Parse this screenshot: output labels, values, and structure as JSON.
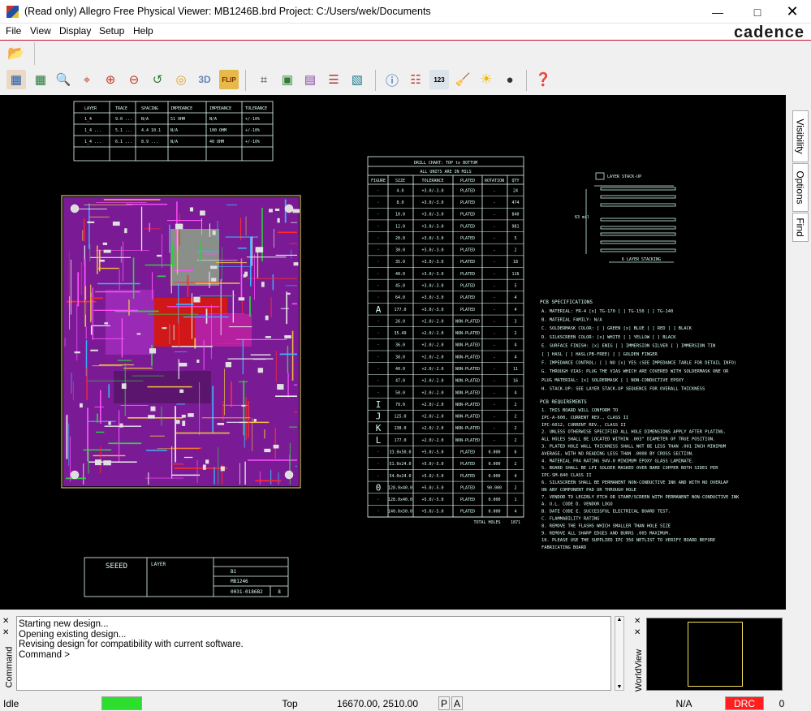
{
  "window": {
    "title": "(Read only) Allegro Free Physical Viewer: MB1246B.brd  Project: C:/Users/wek/Documents"
  },
  "menu": {
    "items": [
      "File",
      "View",
      "Display",
      "Setup",
      "Help"
    ],
    "brand": "cadence"
  },
  "toolbar": {
    "open_icon": "folder-open-icon",
    "buttons": [
      "grid-icon",
      "grid-color-icon",
      "zoom-fit-icon",
      "zoom-points-icon",
      "zoom-in-icon",
      "zoom-out-icon",
      "zoom-previous-icon",
      "redraw-icon",
      "3d-view-icon",
      "flip-board-icon",
      "grid-toggle-icon",
      "color-dialog-icon",
      "layer-visibility-icon",
      "stackup-icon",
      "refresh-icon",
      "info-icon",
      "report-icon",
      "measure-icon",
      "clean-icon",
      "shadow-icon",
      "bomb-icon",
      "help-icon"
    ],
    "labels": {
      "three_d": "3D",
      "flip": "FLIP",
      "measure": "123"
    }
  },
  "canvas": {
    "layer_table": {
      "headers": [
        "LAYER",
        "TRACE",
        "SPACING",
        "IMPEDANCE",
        "IMPEDANCE",
        "TOLERANCE"
      ],
      "rows": [
        [
          "1_4",
          "9.0 ...",
          "N/A",
          "51 OHM",
          "N/A",
          "+/-10%"
        ],
        [
          "1_4 ...",
          "5.1 ...",
          "4.4 10.1",
          "N/A",
          "100 OHM",
          "+/-10%"
        ],
        [
          "1_4 ...",
          "6.1 ...",
          "8.9 ...",
          "N/A",
          "40 OHM",
          "+/-10%"
        ]
      ]
    },
    "drill_chart": {
      "title": "DRILL CHART: TOP to BOTTOM",
      "subtitle": "ALL UNITS ARE IN MILS",
      "headers": [
        "FIGURE",
        "SIZE",
        "TOLERANCE",
        "PLATED",
        "ROTATION",
        "QTY"
      ],
      "rows": [
        [
          "·",
          "4.0",
          "+3.0/-3.0",
          "PLATED",
          "-",
          "24"
        ],
        [
          "·",
          "8.0",
          "+3.0/-3.0",
          "PLATED",
          "-",
          "474"
        ],
        [
          "·",
          "10.0",
          "+3.0/-3.0",
          "PLATED",
          "-",
          "840"
        ],
        [
          "·",
          "12.0",
          "+3.0/-3.0",
          "PLATED",
          "-",
          "981"
        ],
        [
          "·",
          "20.0",
          "+3.0/-3.0",
          "PLATED",
          "-",
          "5"
        ],
        [
          "·",
          "30.0",
          "+3.0/-3.0",
          "PLATED",
          "-",
          "2"
        ],
        [
          "·",
          "35.0",
          "+3.0/-3.0",
          "PLATED",
          "-",
          "18"
        ],
        [
          "·",
          "40.0",
          "+3.0/-3.0",
          "PLATED",
          "-",
          "116"
        ],
        [
          "·",
          "45.0",
          "+3.0/-3.0",
          "PLATED",
          "-",
          "5"
        ],
        [
          "·",
          "64.0",
          "+3.0/-3.0",
          "PLATED",
          "-",
          "4"
        ],
        [
          "A",
          "177.0",
          "+3.0/-3.0",
          "PLATED",
          "-",
          "4"
        ],
        [
          "·",
          "26.0",
          "+2.0/-2.0",
          "NON-PLATED",
          "-",
          "3"
        ],
        [
          "·",
          "35.49",
          "+2.0/-2.0",
          "NON-PLATED",
          "-",
          "2"
        ],
        [
          "·",
          "36.0",
          "+2.0/-2.0",
          "NON-PLATED",
          "-",
          "4"
        ],
        [
          "·",
          "38.0",
          "+2.0/-2.0",
          "NON-PLATED",
          "-",
          "4"
        ],
        [
          "·",
          "40.0",
          "+2.0/-2.0",
          "NON-PLATED",
          "-",
          "11"
        ],
        [
          "·",
          "47.0",
          "+2.0/-2.0",
          "NON-PLATED",
          "-",
          "16"
        ],
        [
          "·",
          "50.0",
          "+2.0/-2.0",
          "NON-PLATED",
          "-",
          "4"
        ],
        [
          "I",
          "79.0",
          "+2.0/-2.0",
          "NON-PLATED",
          "-",
          "2"
        ],
        [
          "J",
          "125.0",
          "+2.0/-2.0",
          "NON-PLATED",
          "-",
          "2"
        ],
        [
          "K",
          "138.0",
          "+2.0/-2.0",
          "NON-PLATED",
          "-",
          "2"
        ],
        [
          "L",
          "177.0",
          "+2.0/-2.0",
          "NON-PLATED",
          "-",
          "2"
        ],
        [
          "·",
          "33.0x50.0",
          "+5.0/-5.0",
          "PLATED",
          "0.000",
          "6"
        ],
        [
          "·",
          "51.0x24.0",
          "+5.0/-5.0",
          "PLATED",
          "0.000",
          "2"
        ],
        [
          "·",
          "54.0x24.0",
          "+5.0/-5.0",
          "PLATED",
          "0.000",
          "4"
        ],
        [
          "0",
          "128.0x40.0",
          "+5.0/-5.0",
          "PLATED",
          "90.000",
          "2"
        ],
        [
          "·",
          "128.0x40.0",
          "+5.0/-5.0",
          "PLATED",
          "0.000",
          "1"
        ],
        [
          "·",
          "140.0x50.0",
          "+5.0/-5.0",
          "PLATED",
          "0.000",
          "4"
        ]
      ],
      "total_label": "TOTAL HOLES",
      "total_value": "1871"
    },
    "stackup": {
      "title": "LAYER STACK-UP",
      "thickness": "63 mil",
      "footer": "6 LAYER STACKING"
    },
    "specs_title": "PCB SPECIFICATIONS",
    "specs": [
      "A. MATERIAL: FR-4      [x] TG-170  [ ] TG-150  [ ] TG-140",
      "B. MATERIAL FAMILY: N/A",
      "C. SOLDERMASK COLOR: [ ] GREEN [x] BLUE [ ] RED [ ] BLACK",
      "D. SILKSCREEN COLOR: [x] WHITE [ ] YELLOW [ ] BLACK",
      "E. SURFACE FINISH: [x] ENIG [ ] IMMERSION SILVER [ ] IMMERSION TIN",
      "                   [ ] HASL [ ] HASL(PB-FREE) [ ] GOLDEN FINGER",
      "F. IMPEDANCE CONTROL: [ ] NO [x] YES (SEE IMPEDANCE TABLE FOR DETAIL INFO)",
      "G. THROUGH VIAS: PLUG THE VIAS WHICH ARE COVERED WITH SOLDERMASK ONE OR",
      "   PLUG MATERIAL: [x] SOLDERMASK [ ] NON-CONDUCTIVE EPOXY",
      "H. STACK-UP: SEE LAYER STACK-UP SEQUENCE FOR OVERALL THICKNESS"
    ],
    "reqs_title": "PCB REQUIREMENTS",
    "reqs": [
      "1. THIS BOARD WILL CONFORM TO",
      "   IPC-A-600, CURRENT REV., CLASS II",
      "   IPC-6012, CURRENT REV., CLASS II",
      "2. UNLESS OTHERWISE SPECIFIED ALL HOLE DIMENSIONS APPLY AFTER PLATING.",
      "   ALL HOLES SHALL BE LOCATED WITHIN .003\" DIAMETER OF TRUE POSITION.",
      "3. PLATED HOLE WALL THICKNESS SHALL NOT BE LESS THAN .001 INCH MINIMUM",
      "   AVERAGE, WITH NO READING LESS THAN .0008 BY CROSS SECTION.",
      "4. MATERIAL FR4 RATING 94V-0 MINIMUM EPOXY GLASS LAMINATE.",
      "5. BOARD SHALL BE LPI SOLDER MASKED OVER BARE COPPER BOTH SIDES PER",
      "   IPC-SM-840 CLASS II",
      "6. SILKSCREEN SHALL BE PERMANENT NON-CONDUCTIVE INK AND WITH NO OVERLAP",
      "   ON ANY COMPONENT PAD OR THROUGH HOLE",
      "7. VENDOR TO LEGIBLY ETCH OR STAMP/SCREEN WITH PERMANENT NON-CONDUCTIVE INK",
      "   A. U.L. CODE        D. VENDOR LOGO",
      "   B. DATE CODE        E. SUCCESSFUL ELECTRICAL BOARD TEST.",
      "   C. FLAMMABILITY RATING",
      "8. REMOVE THE FLASHS WHICH SMALLER THAN HOLE SIZE",
      "9. REMOVE ALL SHARP EDGES AND BURRS .005 MAXIMUM.",
      "10. PLEASE USE THE SUPPLIED IPC 356 NETLIST TO VERIFY BOARD BEFORE",
      "    FABRICATING BOARD"
    ],
    "title_block": {
      "brand": "SEEED",
      "field_label": "LAYER",
      "rev": "B1",
      "part": "MB1246",
      "doc": "0031-0186B2",
      "sheet": "8"
    }
  },
  "side_tabs": [
    "Visibility",
    "Options",
    "Find"
  ],
  "command": {
    "lines": [
      "Starting new design...",
      "Opening existing design...",
      "Revising design for compatibility with current software."
    ],
    "prompt": "Command >",
    "side_label": "Command"
  },
  "worldview": {
    "side_label": "WorldView"
  },
  "status": {
    "state": "Idle",
    "layer": "Top",
    "coords": "16670.00, 2510.00",
    "p": "P",
    "a": "A",
    "mode": "N/A",
    "drc": "DRC",
    "count": "0",
    "indicator_color": "#2cdf2c",
    "drc_color": "#ff1f1f"
  }
}
